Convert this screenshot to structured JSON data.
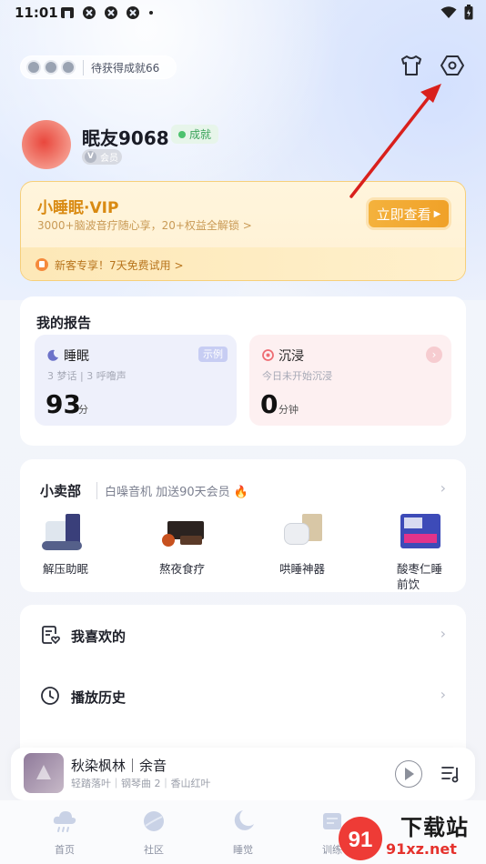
{
  "status_bar": {
    "time": "11:01"
  },
  "header": {
    "achievement_pill": "待获得成就66",
    "icons": [
      "tshirt-icon",
      "settings-hexagon-icon"
    ]
  },
  "profile": {
    "username": "眠友9068",
    "achievement_tag": "成就",
    "member_badge_letter": "V",
    "member_label": "会员"
  },
  "vip_card": {
    "title": "小睡眠·VIP",
    "subtitle": "3000+脑波音疗随心享，20+权益全解锁 >",
    "button_label": "立即查看",
    "trial_text": "新客专享！7天免费试用 >"
  },
  "report": {
    "title": "我的报告",
    "sleep": {
      "title": "睡眠",
      "tag": "示例",
      "note": "3 梦话 | 3 呼噜声",
      "value": "93",
      "unit": "分"
    },
    "immerse": {
      "title": "沉浸",
      "note": "今日未开始沉浸",
      "value": "0",
      "unit": "分钟"
    }
  },
  "shop": {
    "title": "小卖部",
    "promo": "白噪音机 加送90天会员",
    "items": [
      {
        "label": "解压助眠"
      },
      {
        "label": "熬夜食疗"
      },
      {
        "label": "哄睡神器"
      },
      {
        "label": "酸枣仁睡\n前饮"
      }
    ]
  },
  "list": {
    "favorites": "我喜欢的",
    "history": "播放历史"
  },
  "player": {
    "song_title": "秋染枫林｜余音",
    "song_sub": "轻踏落叶｜钢琴曲 2｜香山红叶"
  },
  "tabbar": {
    "tabs": [
      {
        "label": "首页"
      },
      {
        "label": "社区"
      },
      {
        "label": "睡觉"
      },
      {
        "label": "训练"
      }
    ]
  },
  "watermark": {
    "text": "下载站",
    "url": "91xz.net",
    "logo_text": "91"
  },
  "colors": {
    "vip_gold": "#d98a12",
    "vip_button": "#f0a128",
    "annotation_red": "#d9201c",
    "tab_inactive": "#8c92a2"
  }
}
